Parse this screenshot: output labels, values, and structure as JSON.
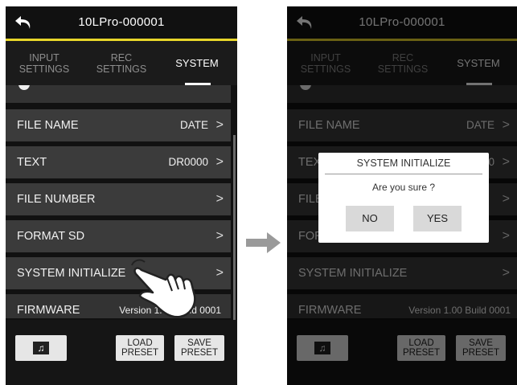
{
  "header": {
    "title": "10LPro-000001"
  },
  "tabs": [
    {
      "label": "INPUT\nSETTINGS"
    },
    {
      "label": "REC\nSETTINGS"
    },
    {
      "label": "SYSTEM"
    }
  ],
  "rows": [
    {
      "label": "FILE NAME",
      "value": "DATE"
    },
    {
      "label": "TEXT",
      "value": "DR0000"
    },
    {
      "label": "FILE NUMBER",
      "value": ""
    },
    {
      "label": "FORMAT SD",
      "value": ""
    },
    {
      "label": "SYSTEM INITIALIZE",
      "value": ""
    },
    {
      "label": "FIRMWARE",
      "value": "Version 1.00 Build 0001"
    }
  ],
  "chevron": ">",
  "bottom": {
    "music_icon": "♫",
    "load_preset": "LOAD\nPRESET",
    "save_preset": "SAVE\nPRESET"
  },
  "dialog": {
    "title": "SYSTEM INITIALIZE",
    "message": "Are you sure ?",
    "no": "NO",
    "yes": "YES"
  },
  "colors": {
    "accent": "#e8d62a",
    "background": "#111111",
    "row": "#3b3b3b"
  },
  "icons": [
    "back-arrow-icon",
    "music-note-icon",
    "right-arrow-icon",
    "hand-pointer-icon"
  ]
}
